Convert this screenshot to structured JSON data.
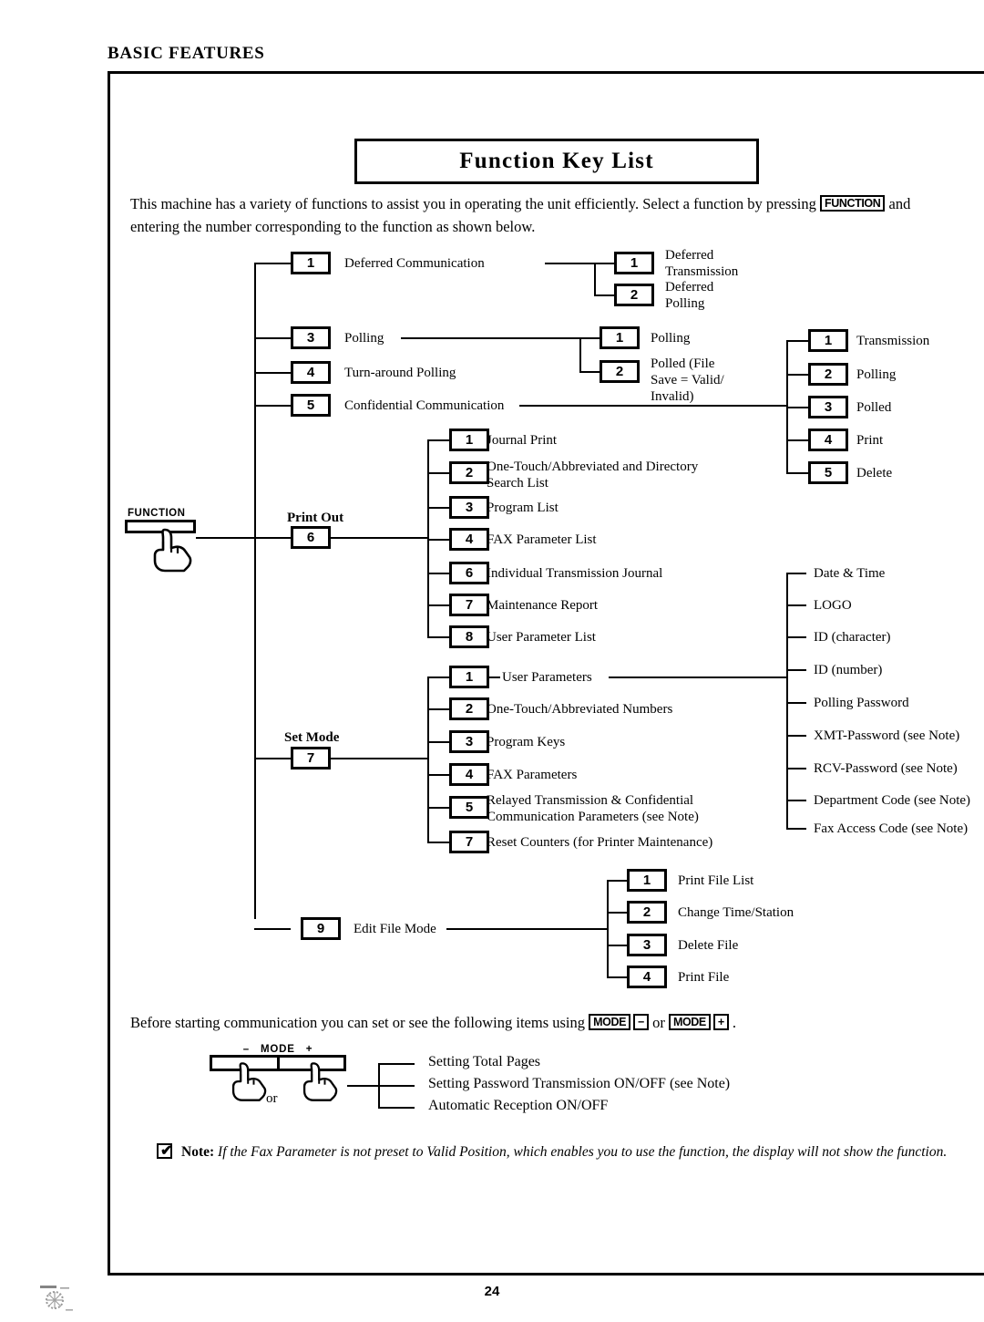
{
  "header": {
    "section": "BASIC FEATURES"
  },
  "title": {
    "text": "Function Key List"
  },
  "intro": {
    "line1_before": "This machine has a variety of functions to assist you in operating the unit efficiently.  Select a function by pressing ",
    "keycap": "FUNCTION",
    "line1_after": " and",
    "line2": "entering the number corresponding to the function as shown below."
  },
  "function_key": {
    "label": "FUNCTION",
    "icon": "pointing-hand-icon"
  },
  "tree": {
    "level1": [
      {
        "num": "1",
        "label": "Deferred Communication"
      },
      {
        "num": "3",
        "label": "Polling"
      },
      {
        "num": "4",
        "label": "Turn-around Polling"
      },
      {
        "num": "5",
        "label": "Confidential Communication"
      },
      {
        "num": "6",
        "label": "",
        "caption": "Print Out"
      },
      {
        "num": "7",
        "label": "",
        "caption": "Set Mode"
      },
      {
        "num": "9",
        "label": "Edit File Mode"
      }
    ],
    "deferred_children": [
      {
        "num": "1",
        "label": "Deferred\nTransmission"
      },
      {
        "num": "2",
        "label": "Deferred\nPolling"
      }
    ],
    "polling_children": [
      {
        "num": "1",
        "label": "Polling"
      },
      {
        "num": "2",
        "label": "Polled (File\nSave = Valid/\nInvalid)"
      }
    ],
    "confidential_children": [
      {
        "num": "1",
        "label": "Transmission"
      },
      {
        "num": "2",
        "label": "Polling"
      },
      {
        "num": "3",
        "label": "Polled"
      },
      {
        "num": "4",
        "label": "Print"
      },
      {
        "num": "5",
        "label": "Delete"
      }
    ],
    "print_out_children": [
      {
        "num": "1",
        "label": "Journal Print"
      },
      {
        "num": "2",
        "label": "One-Touch/Abbreviated and Directory\nSearch List"
      },
      {
        "num": "3",
        "label": "Program List"
      },
      {
        "num": "4",
        "label": "FAX Parameter List"
      },
      {
        "num": "6",
        "label": "Individual Transmission Journal"
      },
      {
        "num": "7",
        "label": "Maintenance Report"
      },
      {
        "num": "8",
        "label": "User Parameter List"
      }
    ],
    "set_mode_children": [
      {
        "num": "1",
        "label": "User Parameters"
      },
      {
        "num": "2",
        "label": "One-Touch/Abbreviated Numbers"
      },
      {
        "num": "3",
        "label": "Program Keys"
      },
      {
        "num": "4",
        "label": "FAX Parameters"
      },
      {
        "num": "5",
        "label": "Relayed Transmission & Confidential\nCommunication Parameters (see Note)"
      },
      {
        "num": "7",
        "label": "Reset Counters (for Printer Maintenance)"
      }
    ],
    "user_parameter_children": [
      {
        "label": "Date & Time"
      },
      {
        "label": "LOGO"
      },
      {
        "label": "ID (character)"
      },
      {
        "label": "ID (number)"
      },
      {
        "label": "Polling Password"
      },
      {
        "label": "XMT-Password (see Note)"
      },
      {
        "label": "RCV-Password (see Note)"
      },
      {
        "label": "Department Code (see Note)"
      },
      {
        "label": "Fax Access Code (see Note)"
      }
    ],
    "edit_file_children": [
      {
        "num": "1",
        "label": "Print File List"
      },
      {
        "num": "2",
        "label": "Change Time/Station"
      },
      {
        "num": "3",
        "label": "Delete File"
      },
      {
        "num": "4",
        "label": "Print File"
      }
    ]
  },
  "mode_section": {
    "intro_before": "Before starting communication you can set or see the following items using ",
    "keycap_mode": "MODE",
    "minus": "−",
    "or": " or ",
    "plus": "+",
    "intro_after": " .",
    "key_art": {
      "minus_label": "–",
      "title": "MODE",
      "plus_label": "+",
      "or_label": "or"
    },
    "items": [
      "Setting Total Pages",
      "Setting Password Transmission ON/OFF (see Note)",
      "Automatic Reception ON/OFF"
    ]
  },
  "note": {
    "checkbox_icon": "checkmark-icon",
    "check_glyph": "✔",
    "label": "Note:",
    "text": " If the Fax Parameter is not preset to Valid Position, which enables you to use the function, the display will not show the function."
  },
  "footer": {
    "page_number": "24"
  }
}
